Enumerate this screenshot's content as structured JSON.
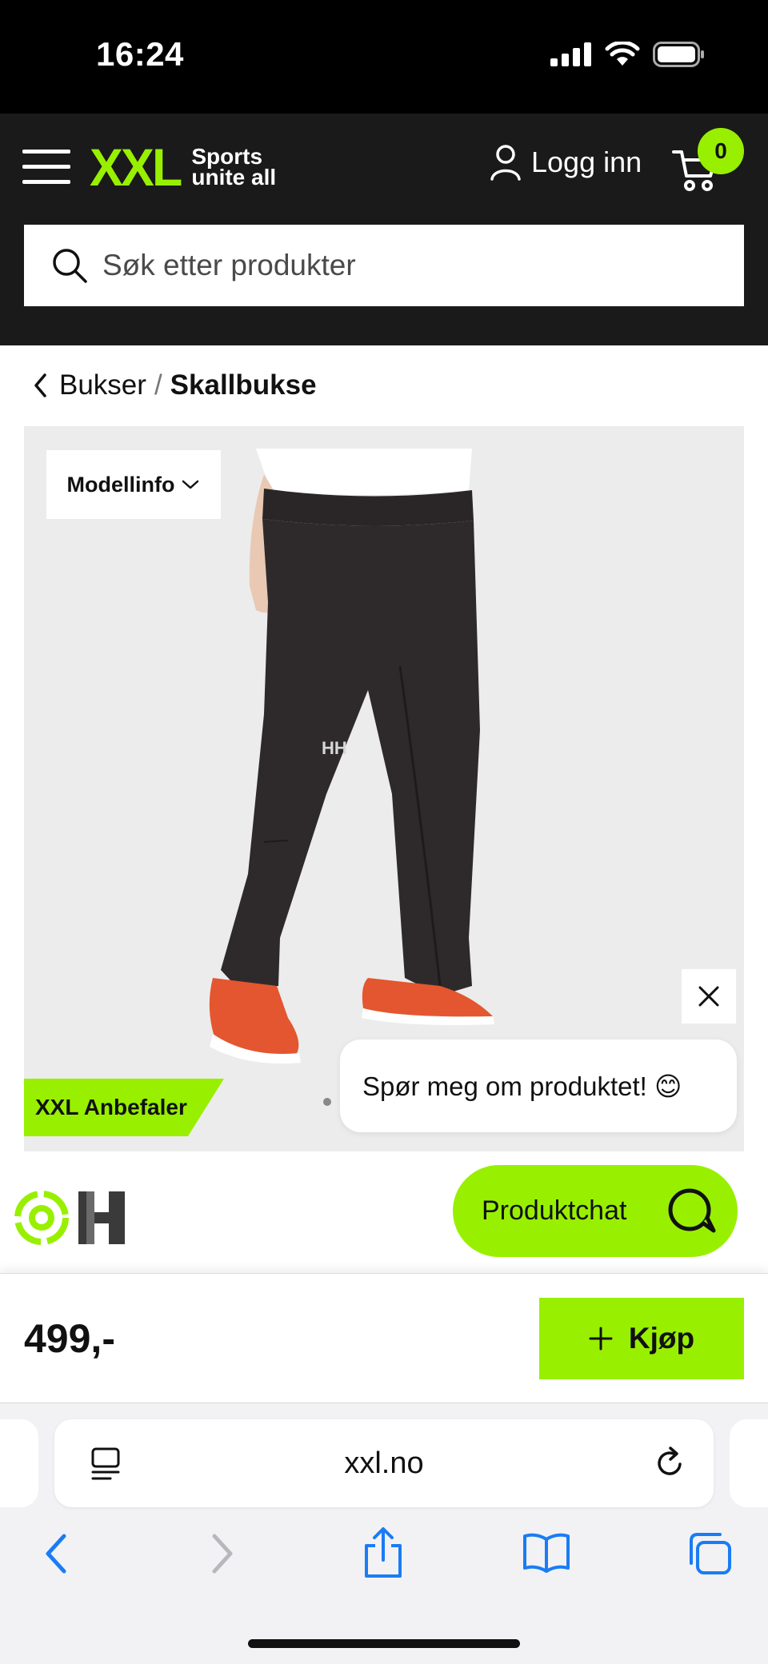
{
  "status_bar": {
    "time": "16:24"
  },
  "header": {
    "logo_primary": "XXL",
    "logo_tagline_line1": "Sports",
    "logo_tagline_line2": "unite all",
    "login_label": "Logg inn",
    "cart_count": "0",
    "search_placeholder": "Søk etter produkter"
  },
  "breadcrumb": {
    "parent": "Bukser",
    "separator": "/",
    "current": "Skallbukse"
  },
  "product": {
    "modellinfo_label": "Modellinfo",
    "badge": "XXL Anbefaler",
    "price": "499,-",
    "buy_label": "Kjøp"
  },
  "chat": {
    "bubble_text": "Spør meg om produktet! 😊",
    "button_label": "Produktchat"
  },
  "browser": {
    "url": "xxl.no"
  },
  "colors": {
    "brand_green": "#98f000",
    "header_bg": "#1a1a1a",
    "safari_blue": "#1a7cf5"
  }
}
